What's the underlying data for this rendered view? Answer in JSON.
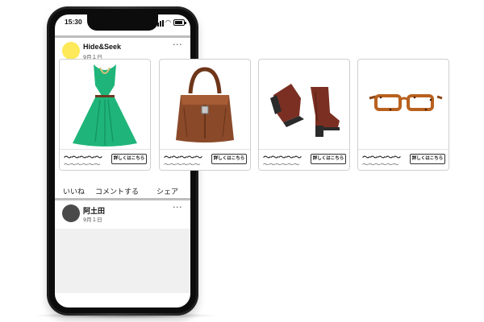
{
  "status_bar": {
    "time": "15:30"
  },
  "posts": [
    {
      "name": "Hide&Seek",
      "date": "9月１日",
      "avatar_color": "#fde95a",
      "more": "···"
    },
    {
      "name": "阿土田",
      "date": "9月１日",
      "avatar_color": "#4a4a4a",
      "more": "···"
    }
  ],
  "actions": {
    "like": "いいね",
    "comment": "コメントする",
    "share": "シェア"
  },
  "products": [
    {
      "image": "green-dress",
      "title": "〜〜〜〜〜",
      "subtitle": "〜〜〜〜〜〜",
      "button": "詳しくはこちら"
    },
    {
      "image": "brown-handbag",
      "title": "〜〜〜〜〜",
      "subtitle": "〜〜〜〜〜〜",
      "button": "詳しくはこちら"
    },
    {
      "image": "brown-boots",
      "title": "〜〜〜〜〜",
      "subtitle": "〜〜〜〜〜〜",
      "button": "詳しくはこちら"
    },
    {
      "image": "tortoiseshell-glasses",
      "title": "〜〜〜〜〜",
      "subtitle": "〜〜〜〜〜〜",
      "button": "詳しくはこちら"
    }
  ],
  "colors": {
    "dress": "#1fb57a",
    "leather": "#8a4a2a",
    "boots": "#7b2f22",
    "frame": "#b8611f"
  }
}
